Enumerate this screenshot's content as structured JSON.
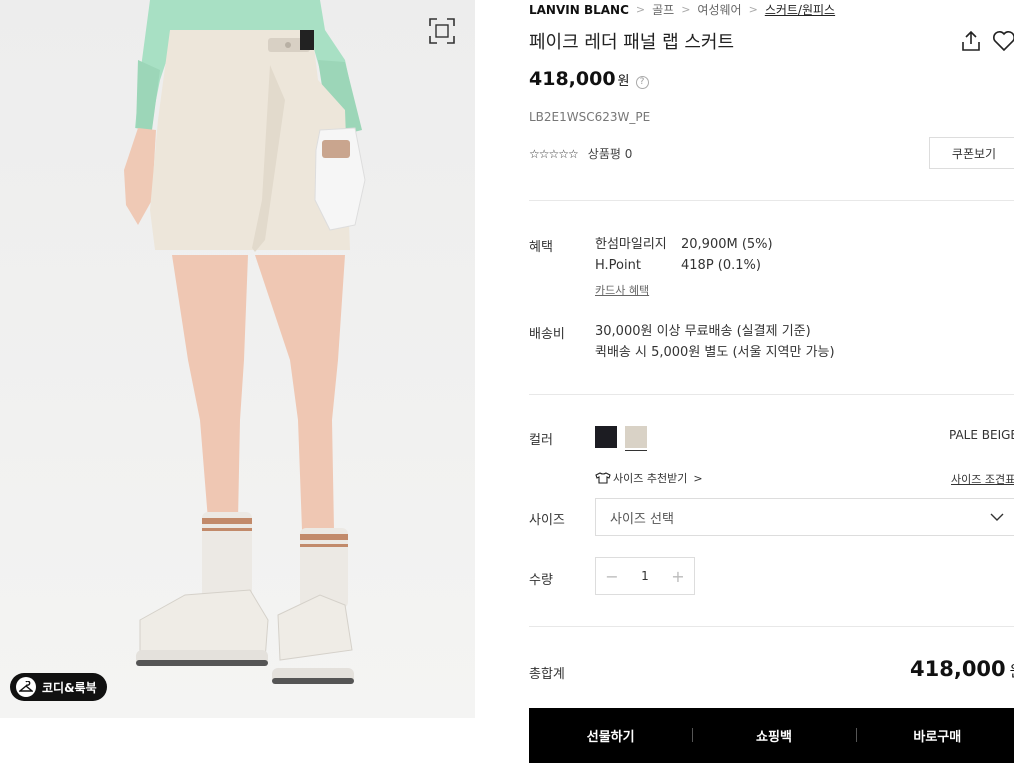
{
  "breadcrumb": {
    "brand": "LANVIN BLANC",
    "items": [
      "골프",
      "여성웨어",
      "스커트/원피스"
    ]
  },
  "product": {
    "title": "페이크 레더 패널 랩 스커트",
    "price": "418,000",
    "currency": "원",
    "help_glyph": "?",
    "sku": "LB2E1WSC623W_PE",
    "stars": "☆☆☆☆☆",
    "review_label": "상품평 0",
    "coupon_label": "쿠폰보기"
  },
  "benefit": {
    "label": "혜택",
    "rows": [
      {
        "name": "한섬마일리지",
        "value": "20,900M (5%)"
      },
      {
        "name": "H.Point",
        "value": "418P (0.1%)"
      }
    ],
    "card_link": "카드사 혜택"
  },
  "shipping": {
    "label": "배송비",
    "line1": "30,000원 이상 무료배송 (실결제 기준)",
    "line2": "퀵배송 시 5,000원 별도 (서울 지역만 가능)"
  },
  "color": {
    "label": "컬러",
    "swatches": [
      {
        "name": "black",
        "hex": "#1c1c22"
      },
      {
        "name": "pale-beige",
        "hex": "#d9d2c6"
      }
    ],
    "selected_name": "PALE BEIGE"
  },
  "size": {
    "label": "사이즈",
    "recommend": "사이즈 추천받기",
    "chart_link": "사이즈 조견표",
    "placeholder": "사이즈 선택"
  },
  "quantity": {
    "label": "수량",
    "value": "1",
    "minus": "−",
    "plus": "+"
  },
  "total": {
    "label": "총합계",
    "amount": "418,000",
    "currency": "원"
  },
  "actions": {
    "gift": "선물하기",
    "cart": "쇼핑백",
    "buy": "바로구매"
  },
  "image": {
    "coordi_label": "코디&룩북"
  },
  "colors": {
    "accent": "#000000",
    "border": "#dddddd"
  }
}
